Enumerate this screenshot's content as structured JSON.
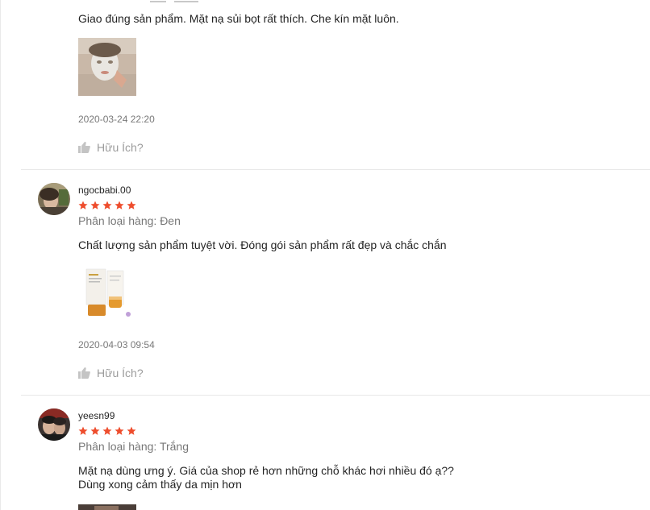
{
  "reviews": [
    {
      "comment": "Giao đúng sản phẩm. Mặt nạ sủi bọt rất thích. Che kín mặt luôn.",
      "timestamp": "2020-03-24 22:20",
      "helpful_label": "Hữu Ích?"
    },
    {
      "username": "ngocbabi.00",
      "rating": 5,
      "variant": "Phân loại hàng: Đen",
      "comment": "Chất lượng sản phẩm tuyệt vời. Đóng gói sản phẩm rất đẹp và chắc chắn",
      "timestamp": "2020-04-03 09:54",
      "helpful_label": "Hữu Ích?"
    },
    {
      "username": "yeesn99",
      "rating": 5,
      "variant": "Phân loại hàng: Trắng",
      "comment_line1": "Mặt nạ dùng ưng ý. Giá của shop rẻ hơn những chỗ khác hơi nhiều đó ạ??",
      "comment_line2": "Dùng xong cảm thấy da mịn hơn"
    }
  ],
  "colors": {
    "star": "#ee4d2d",
    "text": "#222222",
    "muted": "#757575",
    "divider": "#e8e8e8"
  },
  "icons": {
    "helpful": "thumbs-up-icon",
    "rating": "star-icon"
  }
}
